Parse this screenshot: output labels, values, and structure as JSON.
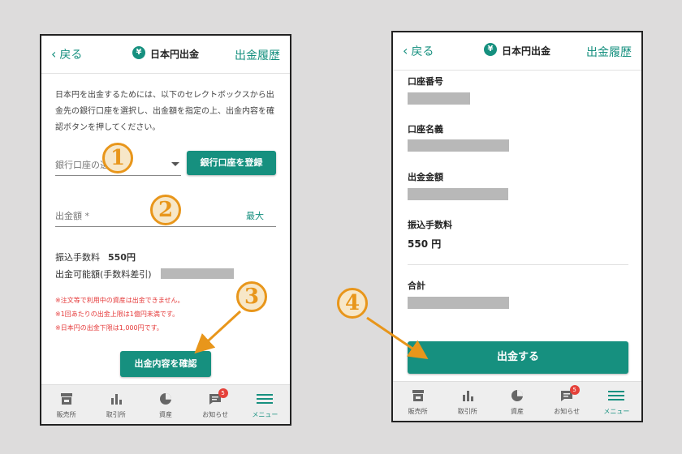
{
  "screen1": {
    "header": {
      "back": "戻る",
      "title": "日本円出金",
      "history": "出金履歴",
      "yen_symbol": "¥"
    },
    "intro": "日本円を出金するためには、以下のセレクトボックスから出金先の銀行口座を選択し、出金額を指定の上、出金内容を確認ボタンを押してください。",
    "bank_select_placeholder": "銀行口座の選択 *",
    "register_bank_button": "銀行口座を登録",
    "amount_placeholder": "出金額 *",
    "max_link": "最大",
    "fee_label": "振込手数料",
    "fee_value": "550円",
    "available_label": "出金可能額(手数料差引)",
    "notes": [
      "※注文等で利用中の資産は出金できません。",
      "※1回あたりの出金上限は1億円未満です。",
      "※日本円の出金下限は1,000円です。"
    ],
    "confirm_button": "出金内容を確認"
  },
  "screen2": {
    "header": {
      "back": "戻る",
      "title": "日本円出金",
      "history": "出金履歴",
      "yen_symbol": "¥"
    },
    "account_number_label": "口座番号",
    "account_name_label": "口座名義",
    "amount_label": "出金金額",
    "fee_label": "振込手数料",
    "fee_value": "550 円",
    "total_label": "合計",
    "withdraw_button": "出金する"
  },
  "tabbar": {
    "items": [
      {
        "label": "販売所",
        "icon": "store-icon"
      },
      {
        "label": "取引所",
        "icon": "bar-chart-icon"
      },
      {
        "label": "資産",
        "icon": "pie-chart-icon"
      },
      {
        "label": "お知らせ",
        "icon": "message-icon",
        "badge": "5"
      },
      {
        "label": "メニュー",
        "icon": "hamburger-menu-icon"
      }
    ]
  },
  "step_markers": [
    "1",
    "2",
    "3",
    "4"
  ],
  "colors": {
    "accent": "#16907f",
    "annotation": "#e8961b",
    "warning": "#e53a3a",
    "badge": "#e5413a"
  }
}
